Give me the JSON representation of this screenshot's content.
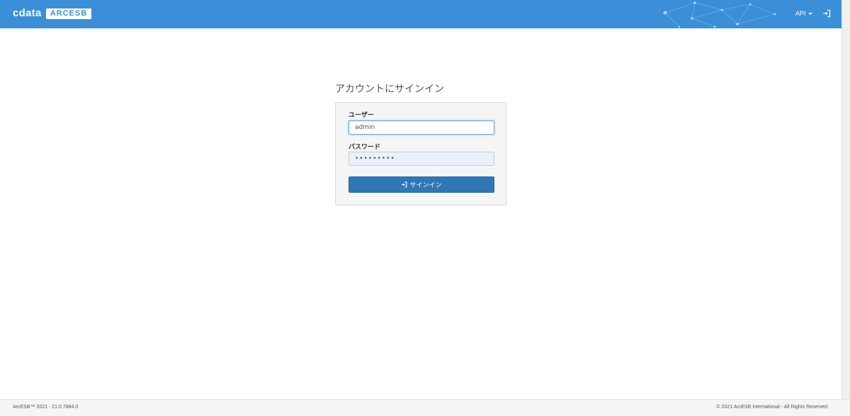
{
  "header": {
    "brand": "cdata",
    "product": "ARCESB",
    "api_menu_label": "API",
    "login_icon": "sign-in-icon",
    "background_color": "#3a8fd8"
  },
  "login": {
    "title": "アカウントにサインイン",
    "username_label": "ユーザー",
    "username_value": "admin",
    "password_label": "パスワード",
    "password_value": "•••••••••",
    "signin_label": "サインイン",
    "signin_icon": "sign-in-icon",
    "button_color": "#2f78b8"
  },
  "footer": {
    "left_text": "ArcESB™ 2021 - 21.0.7884.0",
    "right_text": "© 2021 ArcESB International - All Rights Reserved."
  }
}
